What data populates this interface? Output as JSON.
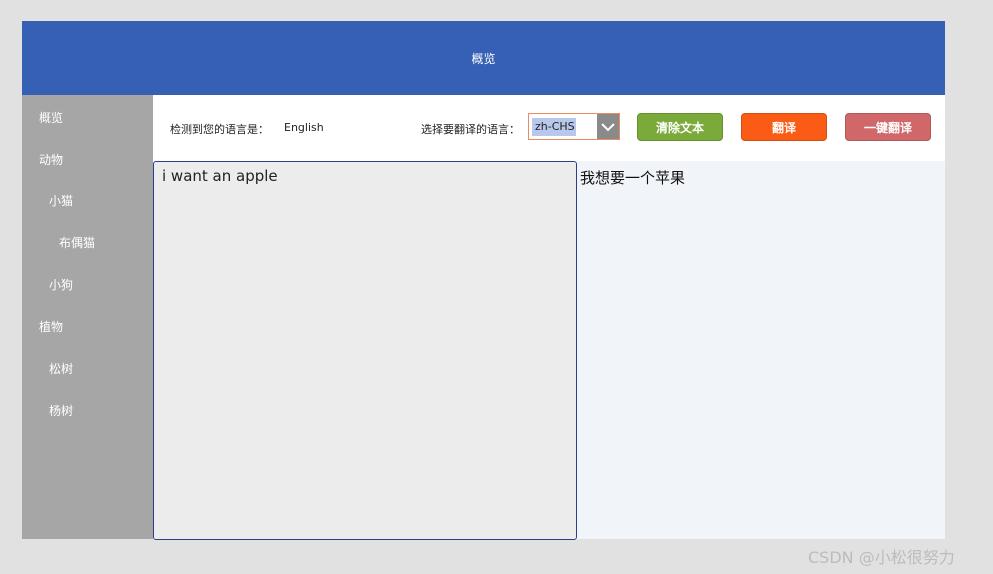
{
  "header": {
    "title": "概览"
  },
  "sidebar": {
    "items": [
      {
        "label": "概览"
      },
      {
        "label": "动物"
      },
      {
        "label": "小猫"
      },
      {
        "label": "布偶猫"
      },
      {
        "label": "小狗"
      },
      {
        "label": "植物"
      },
      {
        "label": "松树"
      },
      {
        "label": "杨树"
      }
    ]
  },
  "toolbar": {
    "detected_label": "检测到您的语言是：",
    "detected_value": "English",
    "target_label": "选择要翻译的语言：",
    "target_value": "zh-CHS",
    "clear_label": "清除文本",
    "translate_label": "翻译",
    "one_click_label": "一键翻译"
  },
  "main": {
    "input_text": "i want an apple",
    "output_text": "我想要一个苹果"
  },
  "colors": {
    "header_bg": "#3660b3",
    "sidebar_bg": "#a6a6a6",
    "clear_button": "#7aab3a",
    "translate_button": "#fa5c15",
    "one_click_button": "#d0686a"
  },
  "icons": {
    "dropdown": "chevron-down-icon"
  },
  "watermark": "CSDN @小松很努力"
}
